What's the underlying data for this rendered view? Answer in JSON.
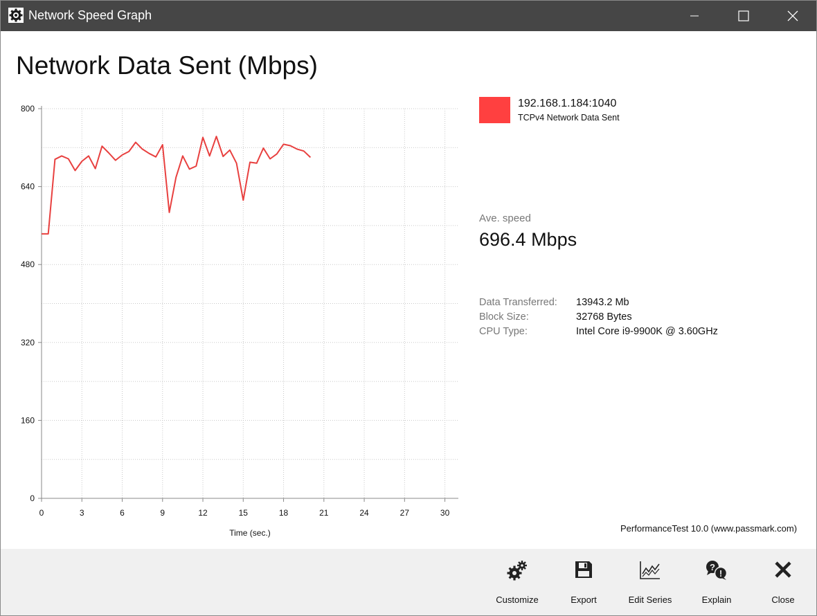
{
  "window": {
    "title": "Network Speed Graph",
    "icon": "passmark-gear-icon",
    "controls": [
      "minimize-icon",
      "maximize-icon",
      "close-icon"
    ]
  },
  "page": {
    "title": "Network Data Sent (Mbps)"
  },
  "chart_data": {
    "type": "line",
    "title": "",
    "xlabel": "Time (sec.)",
    "ylabel": "",
    "xlim": [
      0,
      31
    ],
    "ylim": [
      0,
      800
    ],
    "x_ticks": [
      "0",
      "3",
      "6",
      "9",
      "12",
      "15",
      "18",
      "21",
      "24",
      "27",
      "30"
    ],
    "y_ticks": [
      "0",
      "160",
      "320",
      "480",
      "640",
      "800"
    ],
    "grid": true,
    "series": [
      {
        "name": "192.168.1.184:1040",
        "color": "#e8403f",
        "x": [
          0,
          0.5,
          1,
          1.5,
          2,
          2.5,
          3,
          3.5,
          4,
          4.5,
          5,
          5.5,
          6,
          6.5,
          7,
          7.5,
          8,
          8.5,
          9,
          9.5,
          10,
          10.5,
          11,
          11.5,
          12,
          12.5,
          13,
          13.5,
          14,
          14.5,
          15,
          15.5,
          16,
          16.5,
          17,
          17.5,
          18,
          18.5,
          19,
          19.5,
          20
        ],
        "y": [
          543,
          543,
          696,
          703,
          697,
          673,
          692,
          703,
          677,
          723,
          709,
          694,
          705,
          712,
          731,
          717,
          708,
          701,
          726,
          587,
          659,
          703,
          676,
          682,
          741,
          703,
          743,
          702,
          715,
          688,
          612,
          690,
          688,
          719,
          697,
          707,
          727,
          724,
          717,
          713,
          700
        ]
      }
    ]
  },
  "legend": {
    "color": "#ff4040",
    "name": "192.168.1.184:1040",
    "description": "TCPv4 Network Data Sent"
  },
  "summary": {
    "avg_label": "Ave. speed",
    "avg_value": "696.4 Mbps",
    "stats": [
      {
        "label": "Data Transferred:",
        "value": "13943.2 Mb"
      },
      {
        "label": "Block Size:",
        "value": "32768 Bytes"
      },
      {
        "label": "CPU Type:",
        "value": "Intel Core i9-9900K @ 3.60GHz"
      }
    ]
  },
  "credit": "PerformanceTest 10.0 (www.passmark.com)",
  "toolbar": {
    "customize": {
      "label": "Customize",
      "icon": "gears-icon"
    },
    "export": {
      "label": "Export",
      "icon": "floppy-disk-icon"
    },
    "edit_series": {
      "label": "Edit Series",
      "icon": "line-chart-icon"
    },
    "explain": {
      "label": "Explain",
      "icon": "question-bubbles-icon"
    },
    "close": {
      "label": "Close",
      "icon": "x-icon"
    }
  }
}
